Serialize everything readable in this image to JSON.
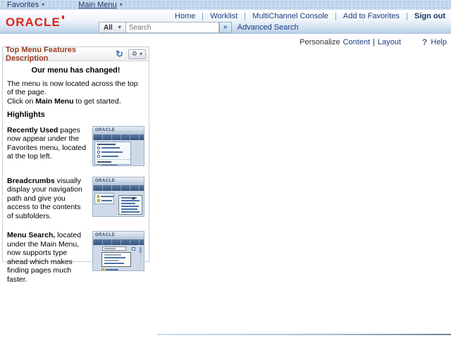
{
  "icons": {
    "chevron_down": "▾",
    "refresh": "↻",
    "gear": "⚙",
    "go": "»",
    "help": "?"
  },
  "topbar": {
    "favorites": "Favorites",
    "main_menu": "Main Menu"
  },
  "header": {
    "logo": "ORACLE",
    "links": {
      "home": "Home",
      "worklist": "Worklist",
      "multichannel": "MultiChannel Console",
      "add_to_favorites": "Add to Favorites",
      "sign_out": "Sign out"
    },
    "search": {
      "scope": "All",
      "placeholder": "Search",
      "advanced": "Advanced Search"
    }
  },
  "personalize": {
    "label": "Personalize",
    "content": "Content",
    "separator": "|",
    "layout": "Layout",
    "help": "Help"
  },
  "pagelet": {
    "title": "Top Menu Features Description",
    "announcement": "Our menu has changed!",
    "intro_line1": "The menu is now located across the top of the page.",
    "intro_click_pre": "Click on ",
    "intro_click_bold": "Main Menu",
    "intro_click_post": " to get started.",
    "highlights_heading": "Highlights",
    "highlights": [
      {
        "bold": "Recently Used",
        "text": " pages now appear under the Favorites menu, located at the top left."
      },
      {
        "bold": "Breadcrumbs",
        "text": " visually display your navigation path and give you access to the contents of subfolders."
      },
      {
        "bold": "Menu Search,",
        "text": " located under the Main Menu, now supports type ahead which makes finding pages much faster."
      }
    ],
    "thumb_logo": "ORACLE"
  }
}
